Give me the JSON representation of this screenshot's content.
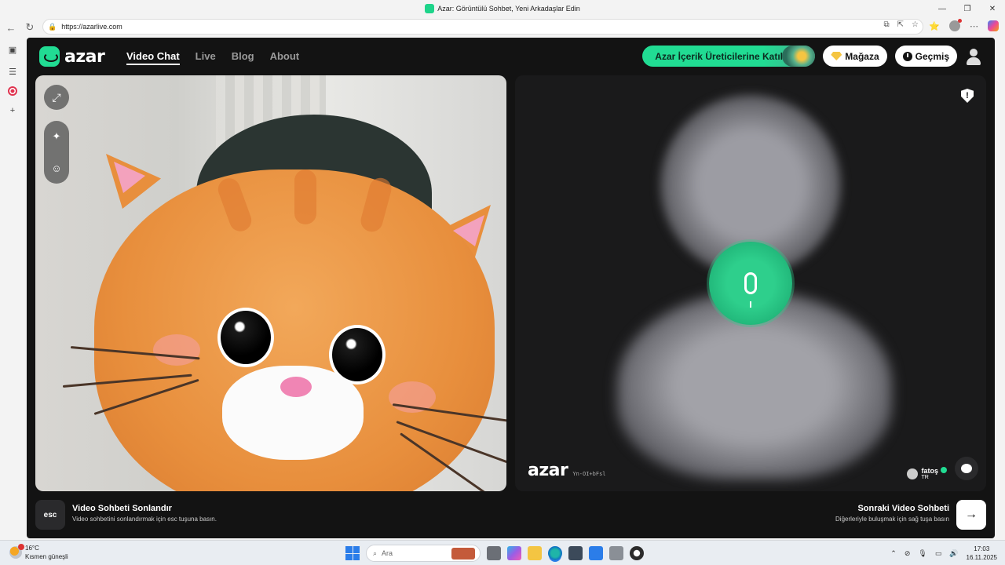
{
  "window": {
    "title": "Azar: Görüntülü Sohbet, Yeni Arkadaşlar Edin",
    "controls": [
      "—",
      "❐",
      "✕"
    ]
  },
  "browser": {
    "url": "https://azarlive.com",
    "back_icon": "←",
    "reload_icon": "↻",
    "lock_icon": "🔒",
    "url_icons": [
      "⧉",
      "⇱",
      "☆"
    ],
    "right_icons": [
      "⭐",
      "⋯"
    ]
  },
  "sidebar": {
    "icons": [
      "▣",
      "☰",
      "+"
    ]
  },
  "header": {
    "logo_text": "azar",
    "nav": [
      {
        "label": "Video Chat",
        "active": true
      },
      {
        "label": "Live",
        "active": false
      },
      {
        "label": "Blog",
        "active": false
      },
      {
        "label": "About",
        "active": false
      }
    ],
    "join_label": "Azar İçerik Üreticilerine Katıl",
    "store_label": "Mağaza",
    "history_label": "Geçmiş"
  },
  "left_video": {
    "controls": [
      "⤢",
      "✦",
      "☺"
    ]
  },
  "right_video": {
    "shield_text": "!",
    "watermark": "azar",
    "code": "Yn-OI+bFsl",
    "peer_name": "fatoş",
    "peer_country": "TR"
  },
  "bottom": {
    "esc_label": "esc",
    "end_title": "Video Sohbeti Sonlandır",
    "end_sub": "Video sohbetini sonlandırmak için esc tuşuna basın.",
    "next_title": "Sonraki Video Sohbeti",
    "next_sub": "Diğerleriyle buluşmak için sağ tuşa basın",
    "next_icon": "→"
  },
  "taskbar": {
    "temp": "16°C",
    "weather": "Kısmen güneşli",
    "search_placeholder": "Ara",
    "search_icon": "⌕",
    "tray_icons": [
      "⌃",
      "⊘",
      "🎙",
      "▭",
      "🔊"
    ],
    "time": "17:03",
    "date": "16.11.2025",
    "colors": {
      "accent": "#21dc93",
      "mic": "#2ecf8c"
    }
  }
}
